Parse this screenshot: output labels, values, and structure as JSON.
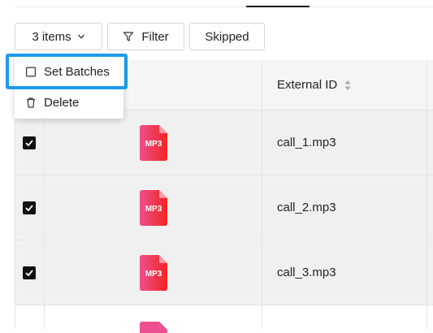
{
  "toolbar": {
    "items_label": "3 items",
    "filter_label": "Filter",
    "skipped_label": "Skipped"
  },
  "menu": {
    "set_batches_label": "Set Batches",
    "delete_label": "Delete"
  },
  "table": {
    "column_external_id": "External ID",
    "rows": [
      {
        "checked": true,
        "file_type": "MP3",
        "external_id": "call_1.mp3"
      },
      {
        "checked": true,
        "file_type": "MP3",
        "external_id": "call_2.mp3"
      },
      {
        "checked": true,
        "file_type": "MP3",
        "external_id": "call_3.mp3"
      }
    ]
  },
  "colors": {
    "highlight": "#1a9bef",
    "mp3_gradient_start": "#ec4f8f",
    "mp3_gradient_end": "#f4251f"
  },
  "icons": [
    "chevron-down-icon",
    "filter-icon",
    "sort-icon",
    "checkbox-outline-icon",
    "trash-icon",
    "checkbox-checked-icon",
    "mp3-file-icon"
  ]
}
